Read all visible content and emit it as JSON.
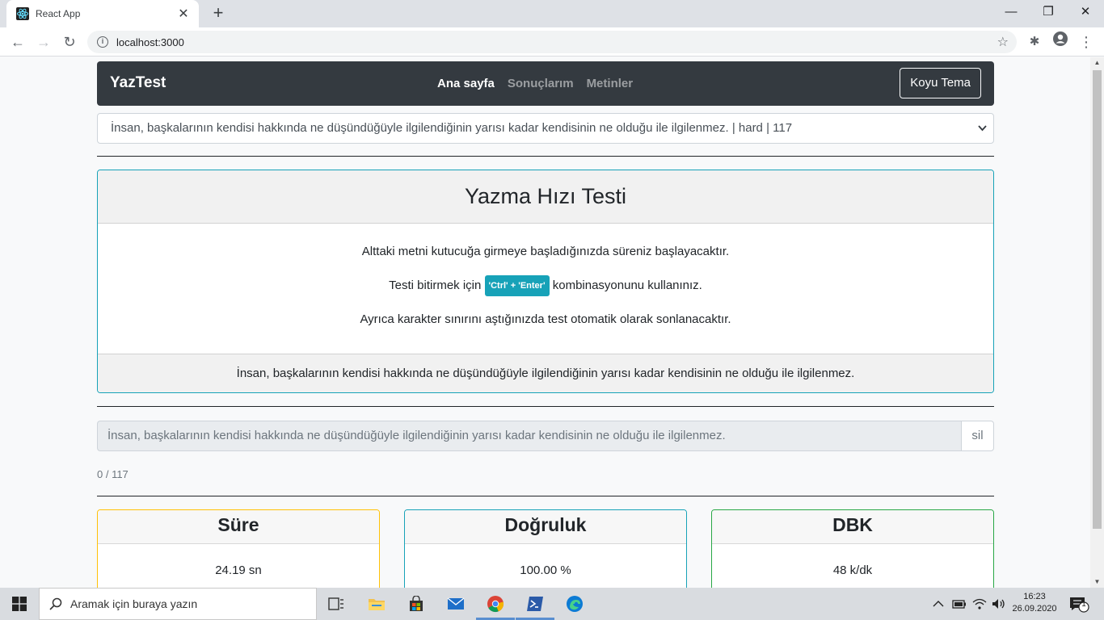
{
  "browser": {
    "tab_title": "React App",
    "url": "localhost:3000"
  },
  "navbar": {
    "brand": "YazTest",
    "links": [
      "Ana sayfa",
      "Sonuçlarım",
      "Metinler"
    ],
    "theme_button": "Koyu Tema"
  },
  "text_select": {
    "selected": "İnsan, başkalarının kendisi hakkında ne düşündüğüyle ilgilendiğinin yarısı kadar kendisinin ne olduğu ile ilgilenmez. | hard | 117"
  },
  "main_card": {
    "title": "Yazma Hızı Testi",
    "line1": "Alttaki metni kutucuğa girmeye başladığınızda süreniz başlayacaktır.",
    "line2_before": "Testi bitirmek için ",
    "line2_badge": "'Ctrl' + 'Enter'",
    "line2_after": " kombinasyonunu kullanınız.",
    "line3": "Ayrıca karakter sınırını aştığınızda test otomatik olarak sonlanacaktır.",
    "footer_text": "İnsan, başkalarının kendisi hakkında ne düşündüğüyle ilgilendiğinin yarısı kadar kendisinin ne olduğu ile ilgilenmez."
  },
  "typing": {
    "input_value": "İnsan, başkalarının kendisi hakkında ne düşündüğüyle ilgilendiğinin yarısı kadar kendisinin ne olduğu ile ilgilenmez.",
    "clear_button": "sil",
    "counter": "0 / 117"
  },
  "stats": {
    "sure": {
      "label": "Süre",
      "value": "24.19 sn",
      "color": "#ffc107"
    },
    "dogruluk": {
      "label": "Doğruluk",
      "value": "100.00 %",
      "color": "#17a2b8"
    },
    "dbk": {
      "label": "DBK",
      "value": "48 k/dk",
      "color": "#28a745"
    }
  },
  "taskbar": {
    "search_placeholder": "Aramak için buraya yazın",
    "time": "16:23",
    "date": "26.09.2020",
    "notification_count": "1"
  }
}
